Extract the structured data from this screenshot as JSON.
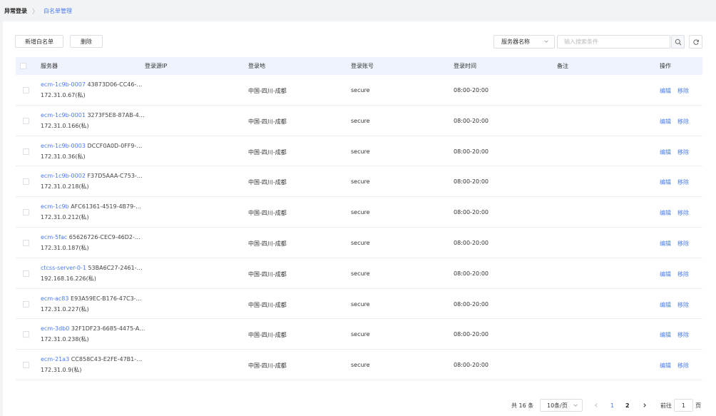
{
  "breadcrumb": {
    "root": "异常登录",
    "separator": "〉",
    "current": "白名单管理"
  },
  "toolbar": {
    "add_label": "新增白名单",
    "delete_label": "删除",
    "filter_select": "服务器名称",
    "search_placeholder": "输入搜索条件"
  },
  "table": {
    "columns": [
      "服务器",
      "登录源IP",
      "登录地",
      "登录账号",
      "登录时间",
      "备注",
      "操作"
    ],
    "rows": [
      {
        "name": "ecm-1c9b-0007",
        "id": "43873D06-CC46-…",
        "ip": "172.31.0.67(私)",
        "source_ip": "",
        "location": "中国-四川-成都",
        "account": "secure",
        "time": "08:00-20:00",
        "note": "",
        "edit": "编辑",
        "remove": "移除"
      },
      {
        "name": "ecm-1c9b-0001",
        "id": "3273F5E8-87AB-4…",
        "ip": "172.31.0.166(私)",
        "source_ip": "",
        "location": "中国-四川-成都",
        "account": "secure",
        "time": "08:00-20:00",
        "note": "",
        "edit": "编辑",
        "remove": "移除"
      },
      {
        "name": "ecm-1c9b-0003",
        "id": "DCCF0A0D-0FF9-…",
        "ip": "172.31.0.36(私)",
        "source_ip": "",
        "location": "中国-四川-成都",
        "account": "secure",
        "time": "08:00-20:00",
        "note": "",
        "edit": "编辑",
        "remove": "移除"
      },
      {
        "name": "ecm-1c9b-0002",
        "id": "F37D5AAA-C753-…",
        "ip": "172.31.0.218(私)",
        "source_ip": "",
        "location": "中国-四川-成都",
        "account": "secure",
        "time": "08:00-20:00",
        "note": "",
        "edit": "编辑",
        "remove": "移除"
      },
      {
        "name": "ecm-1c9b",
        "id": "AFC61361-4519-4B79-…",
        "ip": "172.31.0.212(私)",
        "source_ip": "",
        "location": "中国-四川-成都",
        "account": "secure",
        "time": "08:00-20:00",
        "note": "",
        "edit": "编辑",
        "remove": "移除"
      },
      {
        "name": "ecm-5fac",
        "id": "65626726-CEC9-46D2-…",
        "ip": "172.31.0.187(私)",
        "source_ip": "",
        "location": "中国-四川-成都",
        "account": "secure",
        "time": "08:00-20:00",
        "note": "",
        "edit": "编辑",
        "remove": "移除"
      },
      {
        "name": "ctcss-server-0-1",
        "id": "53BA6C27-2461-…",
        "ip": "192.168.16.226(私)",
        "source_ip": "",
        "location": "中国-四川-成都",
        "account": "secure",
        "time": "08:00-20:00",
        "note": "",
        "edit": "编辑",
        "remove": "移除"
      },
      {
        "name": "ecm-ac83",
        "id": "E93A59EC-B176-47C3-…",
        "ip": "172.31.0.227(私)",
        "source_ip": "",
        "location": "中国-四川-成都",
        "account": "secure",
        "time": "08:00-20:00",
        "note": "",
        "edit": "编辑",
        "remove": "移除"
      },
      {
        "name": "ecm-3db0",
        "id": "32F1DF23-6685-4475-A…",
        "ip": "172.31.0.238(私)",
        "source_ip": "",
        "location": "中国-四川-成都",
        "account": "secure",
        "time": "08:00-20:00",
        "note": "",
        "edit": "编辑",
        "remove": "移除"
      },
      {
        "name": "ecm-21a3",
        "id": "CC858C43-E2FE-47B1-…",
        "ip": "172.31.0.9(私)",
        "source_ip": "",
        "location": "中国-四川-成都",
        "account": "secure",
        "time": "08:00-20:00",
        "note": "",
        "edit": "编辑",
        "remove": "移除"
      }
    ]
  },
  "pagination": {
    "total": "共 16 条",
    "page_size": "10条/页",
    "pages": [
      "1",
      "2"
    ],
    "current_page": "1",
    "jump_prefix": "前往",
    "jump_value": "1",
    "jump_suffix": "页"
  },
  "colors": {
    "accent": "#4a7cf0",
    "header_bg": "#eef3fd",
    "page_bg": "#f2f3f5"
  },
  "icons": [
    "chevron-right-icon",
    "chevron-down-icon",
    "search-icon",
    "refresh-icon",
    "chevron-left-icon"
  ]
}
